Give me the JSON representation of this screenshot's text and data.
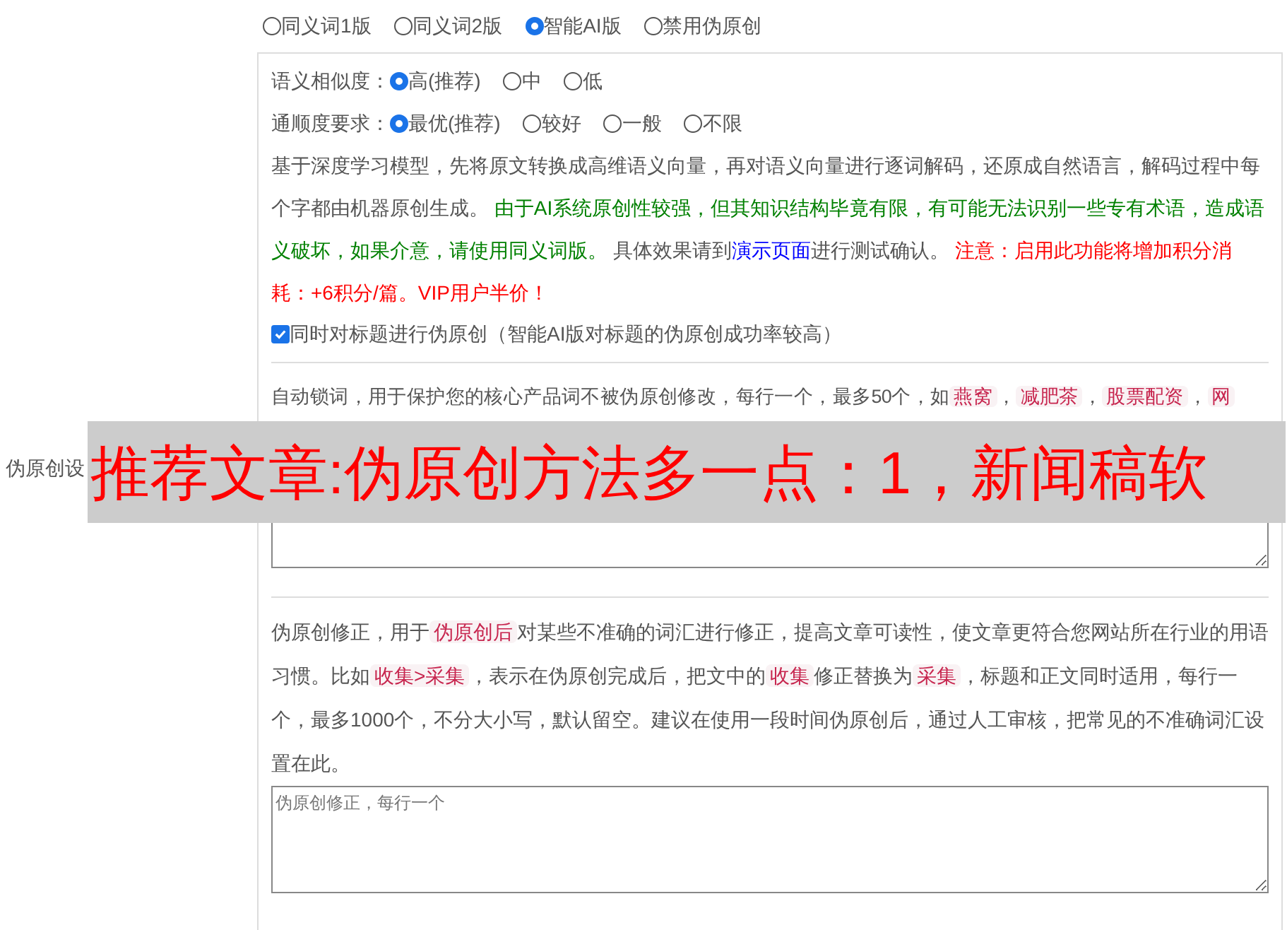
{
  "mode_options": [
    {
      "label": "同义词1版",
      "selected": false
    },
    {
      "label": "同义词2版",
      "selected": false
    },
    {
      "label": "智能AI版",
      "selected": true
    },
    {
      "label": "禁用伪原创",
      "selected": false
    }
  ],
  "settings": [
    {
      "label": "语义相似度：",
      "options": [
        {
          "label": "高(推荐)",
          "selected": true
        },
        {
          "label": "中",
          "selected": false
        },
        {
          "label": "低",
          "selected": false
        }
      ]
    },
    {
      "label": "通顺度要求：",
      "options": [
        {
          "label": "最优(推荐)",
          "selected": true
        },
        {
          "label": "较好",
          "selected": false
        },
        {
          "label": "一般",
          "selected": false
        },
        {
          "label": "不限",
          "selected": false
        }
      ]
    }
  ],
  "ai_description": [
    {
      "kind": "text",
      "text": "基于深度学习模型，先将原文转换成高维语义向量，再对语义向量进行逐词解码，还原成自然语言，解码过程中每个字都由机器原创生成。 "
    },
    {
      "kind": "green",
      "text": "由于AI系统原创性较强，但其知识结构毕竟有限，有可能无法识别一些专有术语，造成语义破坏，如果介意，请使用同义词版。"
    },
    {
      "kind": "text",
      "text": " 具体效果请到"
    },
    {
      "kind": "link",
      "text": "演示页面"
    },
    {
      "kind": "text",
      "text": "进行测试确认。 "
    },
    {
      "kind": "red",
      "text": "注意：启用此功能将增加积分消耗：+6积分/篇。VIP用户半价！"
    }
  ],
  "title_option": {
    "label": "同时对标题进行伪原创（智能AI版对标题的伪原创成功率较高）",
    "checked": true
  },
  "side_label": "伪原创设",
  "lock_words": {
    "description": [
      {
        "kind": "text",
        "text": "自动锁词，用于保护您的核心产品词不被伪原创修改，每行一个，最多50个，如"
      },
      {
        "kind": "code",
        "text": "燕窝"
      },
      {
        "kind": "text",
        "text": "，"
      },
      {
        "kind": "code",
        "text": "减肥茶"
      },
      {
        "kind": "text",
        "text": "，"
      },
      {
        "kind": "code",
        "text": "股票配资"
      },
      {
        "kind": "text",
        "text": "，"
      },
      {
        "kind": "code",
        "text": "网"
      }
    ]
  },
  "correction": {
    "description": [
      {
        "kind": "text",
        "text": "伪原创修正，用于"
      },
      {
        "kind": "code",
        "text": "伪原创后"
      },
      {
        "kind": "text",
        "text": "对某些不准确的词汇进行修正，提高文章可读性，使文章更符合您网站所在行业的用语习惯。比如"
      },
      {
        "kind": "code",
        "text": "收集>采集"
      },
      {
        "kind": "text",
        "text": "，表示在伪原创完成后，把文中的"
      },
      {
        "kind": "code",
        "text": "收集"
      },
      {
        "kind": "text",
        "text": "修正替换为"
      },
      {
        "kind": "code",
        "text": "采集"
      },
      {
        "kind": "text",
        "text": "，标题和正文同时适用，每行一个，最多1000个，不分大小写，默认留空。建议在使用一段时间伪原创后，通过人工审核，把常见的不准确词汇设置在此。"
      }
    ],
    "placeholder": "伪原创修正，每行一个"
  },
  "banner": {
    "text": "推荐文章:伪原创方法多一点：1，新闻稿软"
  }
}
